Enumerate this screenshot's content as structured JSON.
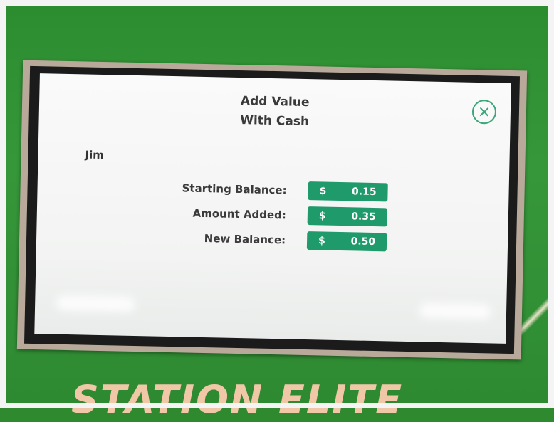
{
  "dialog": {
    "title_line1": "Add Value",
    "title_line2": "With Cash"
  },
  "user": {
    "name": "Jim"
  },
  "balances": [
    {
      "label": "Starting Balance:",
      "currency": "$",
      "amount": "0.15"
    },
    {
      "label": "Amount Added:",
      "currency": "$",
      "amount": "0.35"
    },
    {
      "label": "New Balance:",
      "currency": "$",
      "amount": "0.50"
    }
  ],
  "kiosk": {
    "brand": "STATION ELITE"
  },
  "colors": {
    "accent": "#1f9a6b",
    "kiosk_green": "#2f8a2f"
  },
  "icons": {
    "close": "close-icon"
  }
}
